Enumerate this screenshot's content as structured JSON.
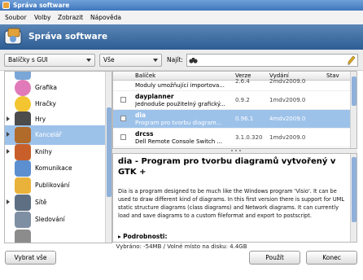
{
  "window": {
    "title": "Správa software"
  },
  "menu": [
    "Soubor",
    "Volby",
    "Zobrazit",
    "Nápověda"
  ],
  "header": {
    "title": "Správa software"
  },
  "filters": {
    "group_value": "Balíčky s GUI",
    "state_value": "Vše",
    "find_label": "Najít:",
    "find_value": ""
  },
  "categories": [
    {
      "label": "",
      "icon": "monitor-icon",
      "color": "#7aa6d8"
    },
    {
      "label": "Grafika",
      "icon": "graphics-icon",
      "color": "#e07ab8"
    },
    {
      "label": "Hračky",
      "icon": "smiley-icon",
      "color": "#f2c531"
    },
    {
      "label": "Hry",
      "icon": "game-icon",
      "color": "#4c4c4c"
    },
    {
      "label": "Kancelář",
      "icon": "office-icon",
      "color": "#b06a2a"
    },
    {
      "label": "Knihy",
      "icon": "book-icon",
      "color": "#c85f2a"
    },
    {
      "label": "Komunikace",
      "icon": "communication-icon",
      "color": "#5b8fd0"
    },
    {
      "label": "Publikování",
      "icon": "publishing-icon",
      "color": "#e9b23a"
    },
    {
      "label": "Sítě",
      "icon": "network-icon",
      "color": "#5e6f84"
    },
    {
      "label": "Sledování",
      "icon": "monitoring-icon",
      "color": "#7f8fa3"
    }
  ],
  "packages": {
    "columns": {
      "package": "Balíček",
      "version": "Verze",
      "release": "Vydání",
      "state": "Stav"
    },
    "rows": [
      {
        "name": "",
        "description": "Moduly umožňující importova...",
        "version": "2.6.4",
        "release": "2mdv2009.0"
      },
      {
        "name": "dayplanner",
        "description": "Jednoduše použitelný grafický...",
        "version": "0.9.2",
        "release": "1mdv2009.0"
      },
      {
        "name": "dia",
        "description": "Program pro tvorbu diagram...",
        "version": "0.96.1",
        "release": "4mdv2009.0"
      },
      {
        "name": "drcss",
        "description": "Dell Remote Console Switch ...",
        "version": "3.1.0.320",
        "release": "1mdv2009.0"
      }
    ]
  },
  "detail": {
    "title": "dia - Program pro tvorbu diagramů vytvořený v GTK +",
    "description": "Dia is a program designed to be much like the Windows program 'Visio'. It can be used to draw different kind of diagrams. In this first version there is support for UML static structure diagrams (class diagrams) and Network diagrams. It can currently load and save diagrams to a custom fileformat and export to postscript.",
    "more": "Podrobnosti:"
  },
  "status": "Vybráno: -54MB / Volné místo na disku: 4.4GB",
  "buttons": {
    "select_all": "Vybrat vše",
    "apply": "Použít",
    "quit": "Konec"
  }
}
